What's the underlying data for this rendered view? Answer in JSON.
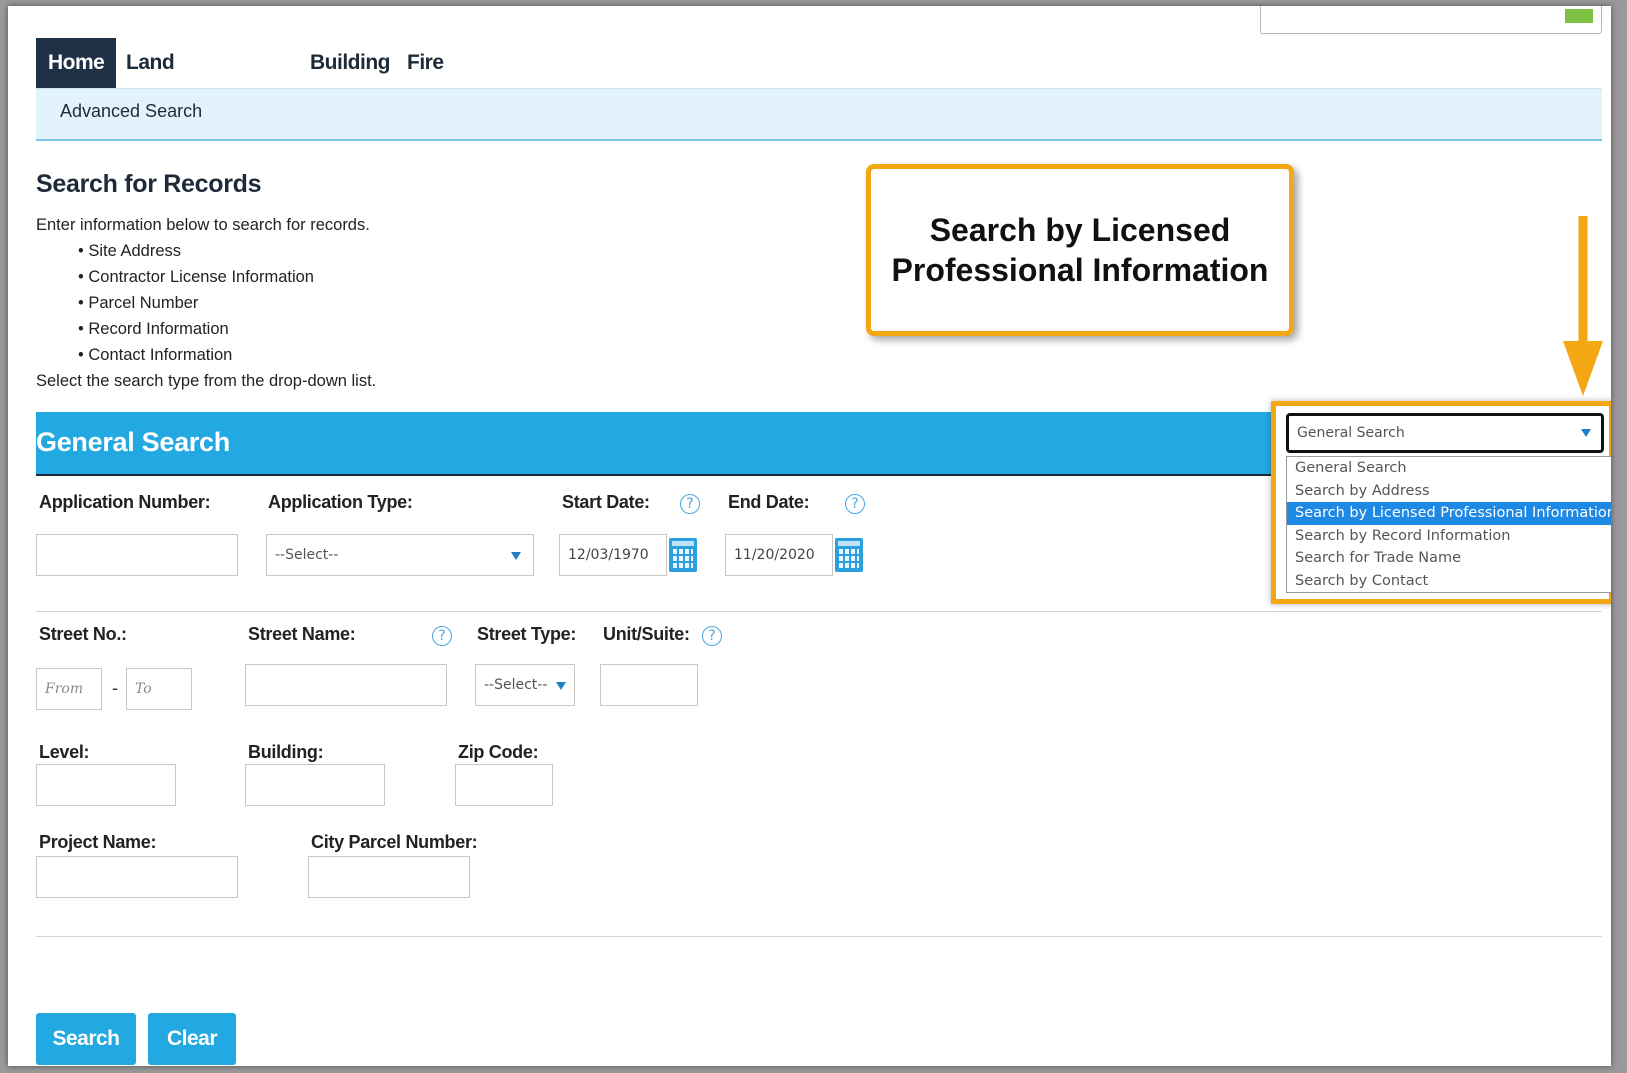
{
  "nav": {
    "tabs": [
      {
        "label": "Home"
      },
      {
        "label": "Land Development"
      },
      {
        "label": "Building"
      },
      {
        "label": "Fire"
      }
    ],
    "subnav": {
      "label": "Advanced Search"
    }
  },
  "page": {
    "title": "Search for Records",
    "intro": "Enter information below to search for records.",
    "bullets": [
      "Site Address",
      "Contractor License Information",
      "Parcel Number",
      "Record Information",
      "Contact Information"
    ],
    "instruction": "Select the search type from the drop-down list."
  },
  "callout": {
    "line1": "Search by Licensed",
    "line2": "Professional Information"
  },
  "section": {
    "title": "General Search"
  },
  "search_type": {
    "selected_value": "General Search",
    "options": [
      "General Search",
      "Search by Address",
      "Search by Licensed Professional Information",
      "Search by Record Information",
      "Search for Trade Name",
      "Search by Contact"
    ],
    "highlighted_option": "Search by Licensed Professional Information"
  },
  "form": {
    "application_number": {
      "label": "Application Number:",
      "value": ""
    },
    "application_type": {
      "label": "Application Type:",
      "value": "--Select--"
    },
    "start_date": {
      "label": "Start Date:",
      "value": "12/03/1970"
    },
    "end_date": {
      "label": "End Date:",
      "value": "11/20/2020"
    },
    "street_no": {
      "label": "Street No.:",
      "from_placeholder": "From",
      "to_placeholder": "To",
      "separator": "-"
    },
    "street_name": {
      "label": "Street Name:",
      "value": ""
    },
    "street_type": {
      "label": "Street Type:",
      "value": "--Select--"
    },
    "unit_suite": {
      "label": "Unit/Suite:",
      "value": ""
    },
    "level": {
      "label": "Level:",
      "value": ""
    },
    "building": {
      "label": "Building:",
      "value": ""
    },
    "zip_code": {
      "label": "Zip Code:",
      "value": ""
    },
    "project_name": {
      "label": "Project Name:",
      "value": ""
    },
    "city_parcel_number": {
      "label": "City Parcel Number:",
      "value": ""
    },
    "help_glyph": "?"
  },
  "buttons": {
    "search": "Search",
    "clear": "Clear"
  },
  "colors": {
    "nav_active": "#1e3146",
    "section_bar": "#22a9e1",
    "callout_border": "#f3a712",
    "selected_option": "#1e88e5"
  }
}
